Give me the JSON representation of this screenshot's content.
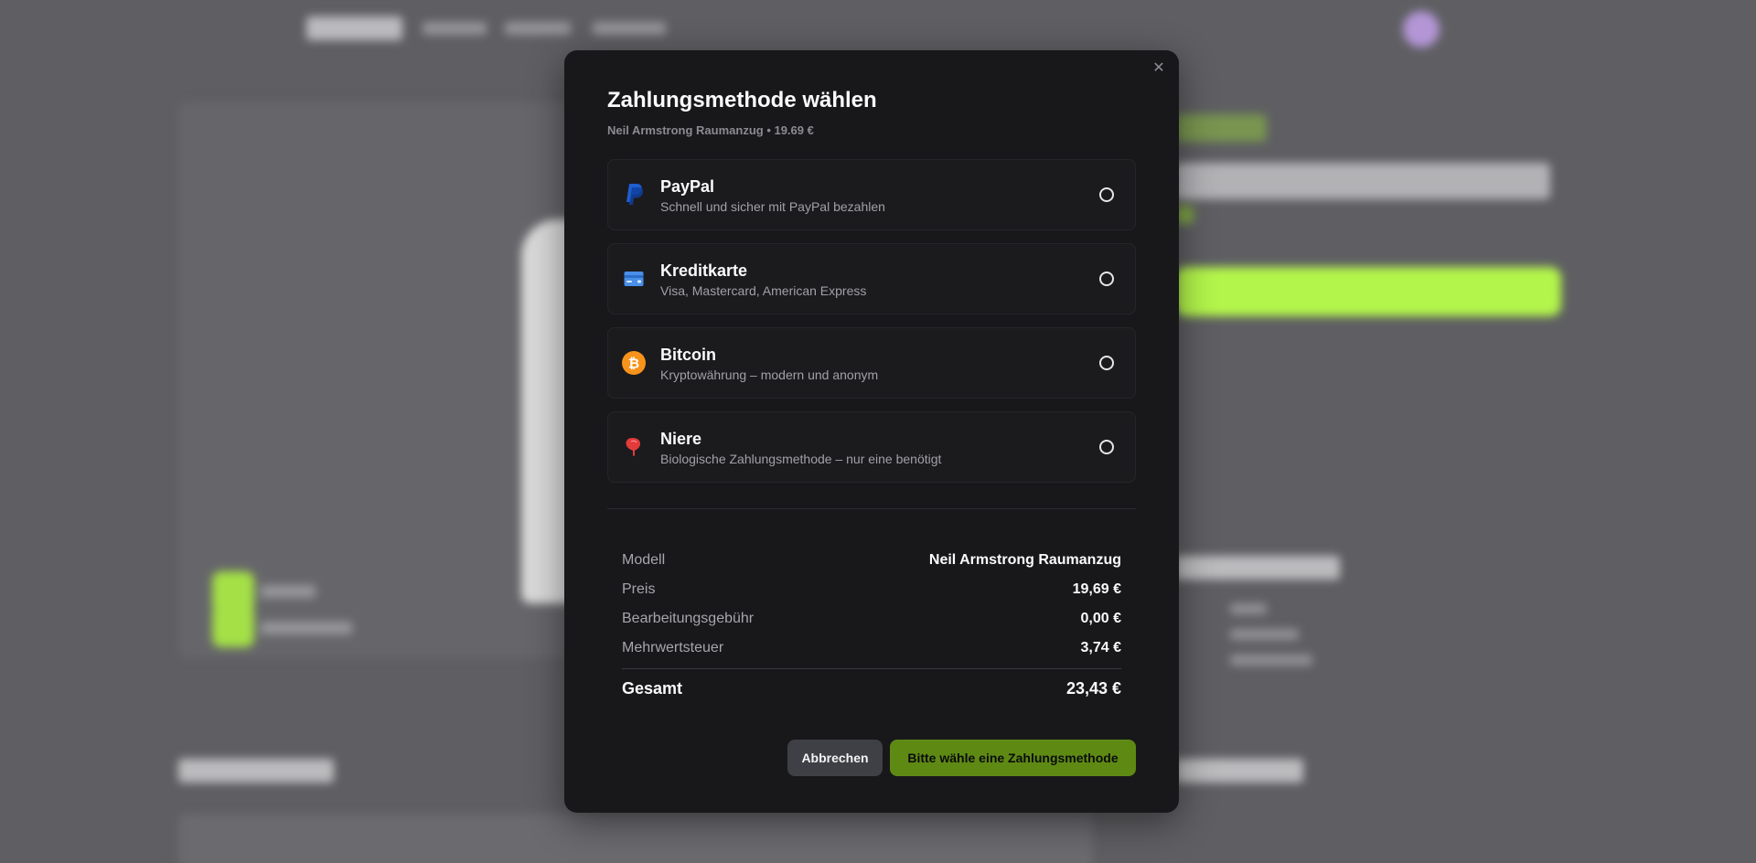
{
  "modal": {
    "title": "Zahlungsmethode wählen",
    "subtitle": "Neil Armstrong Raumanzug • 19.69 €",
    "close_icon": "close-icon",
    "methods": [
      {
        "name": "PayPal",
        "description": "Schnell und sicher mit PayPal bezahlen",
        "icon": "paypal-icon",
        "color": "#1f5fcf"
      },
      {
        "name": "Kreditkarte",
        "description": "Visa, Mastercard, American Express",
        "icon": "credit-card-icon",
        "color": "#4a8fe8"
      },
      {
        "name": "Bitcoin",
        "description": "Kryptowährung – modern und anonym",
        "icon": "bitcoin-icon",
        "color": "#f7931a"
      },
      {
        "name": "Niere",
        "description": "Biologische Zahlungsmethode – nur eine benötigt",
        "icon": "kidney-icon",
        "color": "#e23b3b"
      }
    ],
    "summary": {
      "rows": [
        {
          "label": "Modell",
          "value": "Neil Armstrong Raumanzug"
        },
        {
          "label": "Preis",
          "value": "19,69 €"
        },
        {
          "label": "Bearbeitungsgebühr",
          "value": "0,00 €"
        },
        {
          "label": "Mehrwertsteuer",
          "value": "3,74 €"
        }
      ],
      "total_label": "Gesamt",
      "total_value": "23,43 €"
    },
    "buttons": {
      "cancel": "Abbrechen",
      "confirm": "Bitte wähle eine Zahlungsmethode"
    }
  },
  "colors": {
    "overlay": "#5f5f63",
    "modal_bg": "#18181b",
    "accent_green": "#5e8a14",
    "background_cta": "#b3f54b"
  }
}
